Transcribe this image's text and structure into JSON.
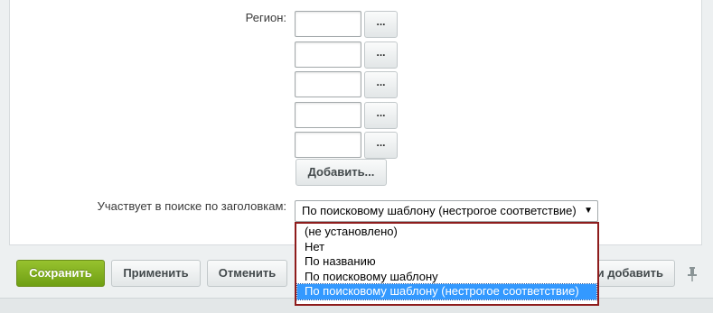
{
  "form": {
    "region_label": "Регион:",
    "region_inputs": [
      "",
      "",
      "",
      "",
      ""
    ],
    "dots_label": "...",
    "add_label": "Добавить...",
    "search_label": "Участвует в поиске по заголовкам:",
    "search_select": {
      "selected": "По поисковому шаблону (нестрогое соответствие)",
      "options": [
        "(не установлено)",
        "Нет",
        "По названию",
        "По поисковому шаблону",
        "По поисковому шаблону (нестрогое соответствие)"
      ],
      "selected_index": 4
    }
  },
  "footer": {
    "save_label": "Сохранить",
    "apply_label": "Применить",
    "cancel_label": "Отменить",
    "save_and_add_label": "и добавить"
  },
  "icons": {
    "pin": "pin-icon",
    "dropdown_arrow": "chevron-down-icon"
  },
  "colors": {
    "save_button": "#7fae1f",
    "selected_option": "#3399ff",
    "dropdown_border": "#8e1c1c"
  }
}
